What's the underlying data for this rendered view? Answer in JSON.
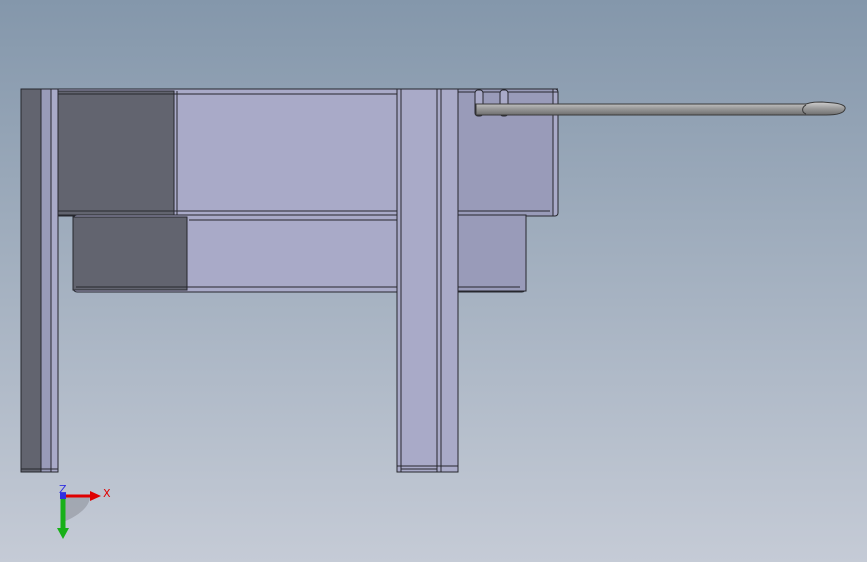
{
  "viewport": {
    "background_top": "#8497ab",
    "background_bottom": "#c5cbd6"
  },
  "model_colors": {
    "light_face": "#a9aac8",
    "medium_face": "#999bb9",
    "dark_face": "#62646f",
    "edge": "#26272e",
    "rod": "#a3a3a3"
  },
  "triad": {
    "x_label": "X",
    "z_label": "Z",
    "x_color": "#e00000",
    "y_color": "#18b018",
    "z_color": "#3030e0"
  }
}
